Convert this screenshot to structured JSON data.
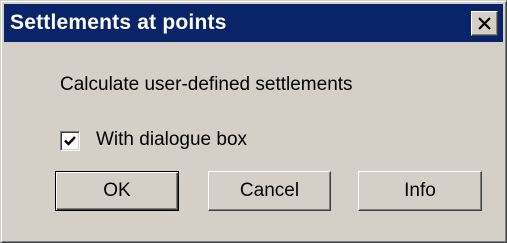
{
  "window": {
    "title": "Settlements at points",
    "close_icon": "close-icon"
  },
  "content": {
    "caption": "Calculate user-defined settlements",
    "checkbox": {
      "label": "With dialogue box",
      "checked": true
    }
  },
  "buttons": {
    "ok": "OK",
    "cancel": "Cancel",
    "info": "Info"
  },
  "colors": {
    "titlebar": "#0a246a",
    "title_text": "#ffffff",
    "dialog_face": "#d4d0c8"
  }
}
